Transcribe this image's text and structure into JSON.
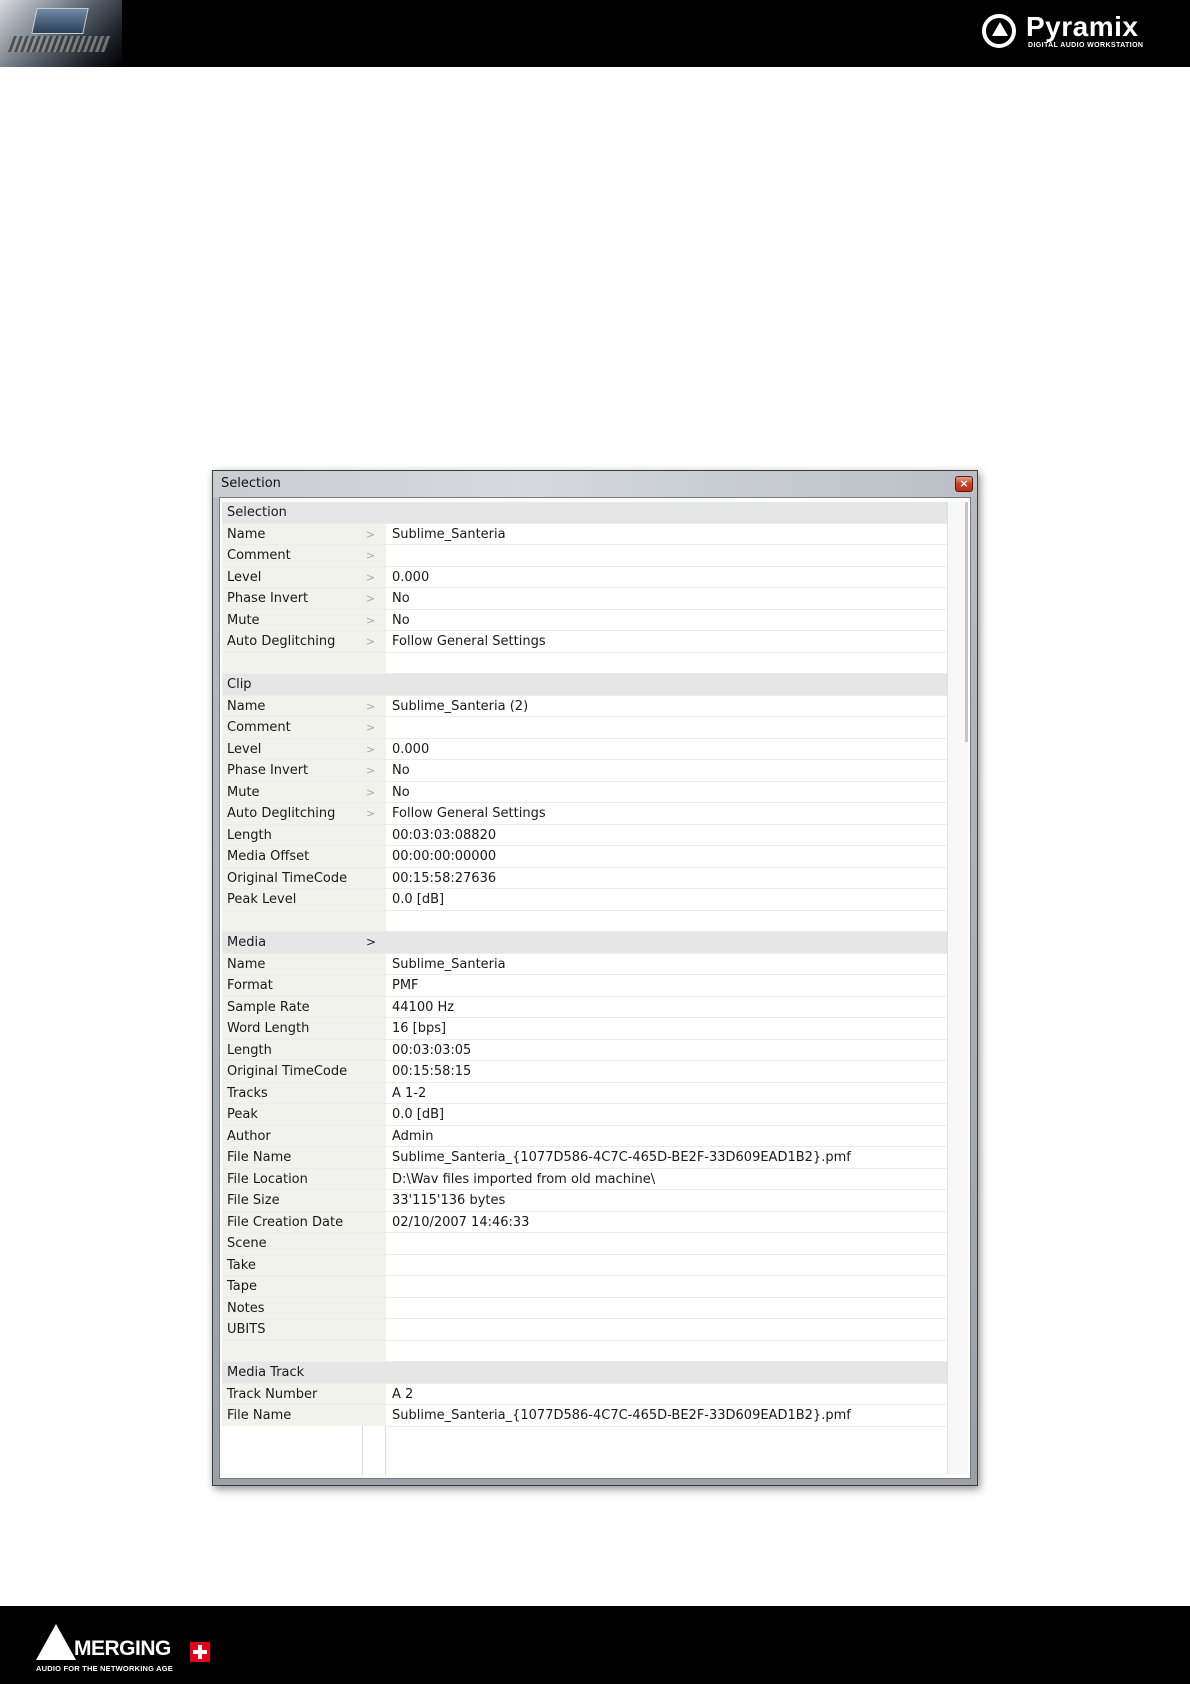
{
  "header": {
    "brand": "Pyramix",
    "tagline": "DIGITAL AUDIO WORKSTATION"
  },
  "footer": {
    "brand": "MERGING",
    "tagline": "AUDIO FOR THE NETWORKING AGE"
  },
  "dialog": {
    "title": "Selection",
    "close_glyph": "×",
    "sections": [
      {
        "title": "Selection",
        "header_arrow": "",
        "rows": [
          {
            "label": "Name",
            "arrow": ">",
            "value": "Sublime_Santeria"
          },
          {
            "label": "Comment",
            "arrow": ">",
            "value": ""
          },
          {
            "label": "Level",
            "arrow": ">",
            "value": "0.000"
          },
          {
            "label": "Phase Invert",
            "arrow": ">",
            "value": "No"
          },
          {
            "label": "Mute",
            "arrow": ">",
            "value": "No"
          },
          {
            "label": "Auto Deglitching",
            "arrow": ">",
            "value": "Follow General Settings"
          }
        ]
      },
      {
        "title": "Clip",
        "header_arrow": "",
        "rows": [
          {
            "label": "Name",
            "arrow": ">",
            "value": "Sublime_Santeria (2)"
          },
          {
            "label": "Comment",
            "arrow": ">",
            "value": ""
          },
          {
            "label": "Level",
            "arrow": ">",
            "value": "0.000"
          },
          {
            "label": "Phase Invert",
            "arrow": ">",
            "value": "No"
          },
          {
            "label": "Mute",
            "arrow": ">",
            "value": "No"
          },
          {
            "label": "Auto Deglitching",
            "arrow": ">",
            "value": "Follow General Settings"
          },
          {
            "label": "Length",
            "arrow": "",
            "value": "00:03:03:08820"
          },
          {
            "label": "Media Offset",
            "arrow": "",
            "value": "00:00:00:00000"
          },
          {
            "label": "Original TimeCode",
            "arrow": "",
            "value": "00:15:58:27636"
          },
          {
            "label": "Peak Level",
            "arrow": "",
            "value": "0.0 [dB]"
          }
        ]
      },
      {
        "title": "Media",
        "header_arrow": ">",
        "rows": [
          {
            "label": "Name",
            "arrow": "",
            "value": "Sublime_Santeria"
          },
          {
            "label": "Format",
            "arrow": "",
            "value": "PMF"
          },
          {
            "label": "Sample Rate",
            "arrow": "",
            "value": "44100 Hz"
          },
          {
            "label": "Word Length",
            "arrow": "",
            "value": "16 [bps]"
          },
          {
            "label": "Length",
            "arrow": "",
            "value": "00:03:03:05"
          },
          {
            "label": "Original TimeCode",
            "arrow": "",
            "value": "00:15:58:15"
          },
          {
            "label": "Tracks",
            "arrow": "",
            "value": "A 1-2"
          },
          {
            "label": "Peak",
            "arrow": "",
            "value": "0.0 [dB]"
          },
          {
            "label": "Author",
            "arrow": "",
            "value": "Admin"
          },
          {
            "label": "File Name",
            "arrow": "",
            "value": "Sublime_Santeria_{1077D586-4C7C-465D-BE2F-33D609EAD1B2}.pmf"
          },
          {
            "label": "File Location",
            "arrow": "",
            "value": "D:\\Wav files imported from old machine\\"
          },
          {
            "label": "File Size",
            "arrow": "",
            "value": "33'115'136 bytes"
          },
          {
            "label": "File Creation Date",
            "arrow": "",
            "value": "02/10/2007 14:46:33"
          },
          {
            "label": "Scene",
            "arrow": "",
            "value": ""
          },
          {
            "label": "Take",
            "arrow": "",
            "value": ""
          },
          {
            "label": "Tape",
            "arrow": "",
            "value": ""
          },
          {
            "label": "Notes",
            "arrow": "",
            "value": ""
          },
          {
            "label": "UBITS",
            "arrow": "",
            "value": ""
          }
        ]
      },
      {
        "title": "Media Track",
        "header_arrow": "",
        "rows": [
          {
            "label": "Track Number",
            "arrow": "",
            "value": "A 2"
          },
          {
            "label": "File Name",
            "arrow": "",
            "value": "Sublime_Santeria_{1077D586-4C7C-465D-BE2F-33D609EAD1B2}.pmf"
          }
        ]
      }
    ]
  }
}
